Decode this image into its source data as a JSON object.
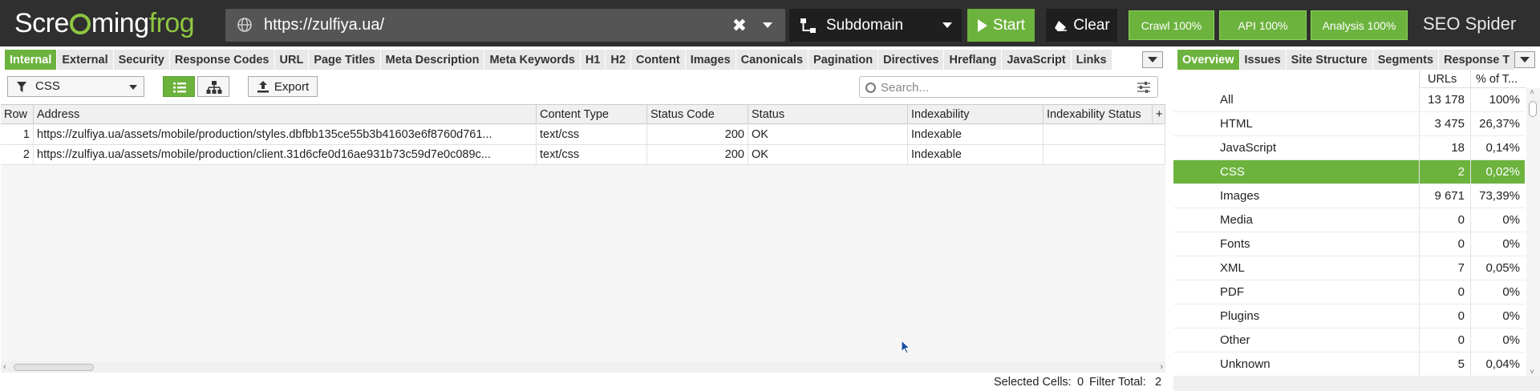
{
  "app": {
    "logo_prefix": "Scre",
    "logo_middle": "ming",
    "logo_suffix": "frog",
    "brand": "SEO Spider"
  },
  "url_bar": {
    "value": "https://zulfiya.ua/",
    "clear_glyph": "✖"
  },
  "mode": {
    "label": "Subdomain"
  },
  "buttons": {
    "start": "Start",
    "clear": "Clear",
    "export": "Export"
  },
  "progress": {
    "crawl": "Crawl 100%",
    "api": "API 100%",
    "analysis": "Analysis 100%"
  },
  "tabs_left": [
    "Internal",
    "External",
    "Security",
    "Response Codes",
    "URL",
    "Page Titles",
    "Meta Description",
    "Meta Keywords",
    "H1",
    "H2",
    "Content",
    "Images",
    "Canonicals",
    "Pagination",
    "Directives",
    "Hreflang",
    "JavaScript",
    "Links"
  ],
  "tabs_right": [
    "Overview",
    "Issues",
    "Site Structure",
    "Segments",
    "Response T"
  ],
  "filter": {
    "value": "CSS"
  },
  "search": {
    "placeholder": "Search..."
  },
  "table": {
    "columns": [
      "Row",
      "Address",
      "Content Type",
      "Status Code",
      "Status",
      "Indexability",
      "Indexability Status"
    ],
    "add_column_glyph": "+",
    "rows": [
      {
        "row": "1",
        "address": "https://zulfiya.ua/assets/mobile/production/styles.dbfbb135ce55b3b41603e6f8760d761...",
        "content_type": "text/css",
        "status_code": "200",
        "status": "OK",
        "indexability": "Indexable",
        "indexability_status": ""
      },
      {
        "row": "2",
        "address": "https://zulfiya.ua/assets/mobile/production/client.31d6cfe0d16ae931b73c59d7e0c089c...",
        "content_type": "text/css",
        "status_code": "200",
        "status": "OK",
        "indexability": "Indexable",
        "indexability_status": ""
      }
    ]
  },
  "status_bar": {
    "selected_label": "Selected Cells:",
    "selected_value": "0",
    "filter_label": "Filter Total:",
    "filter_value": "2"
  },
  "overview": {
    "headers": {
      "urls": "URLs",
      "pct": "% of T..."
    },
    "rows": [
      {
        "label": "All",
        "count": "13 178",
        "pct": "100%",
        "selected": false
      },
      {
        "label": "HTML",
        "count": "3 475",
        "pct": "26,37%",
        "selected": false
      },
      {
        "label": "JavaScript",
        "count": "18",
        "pct": "0,14%",
        "selected": false
      },
      {
        "label": "CSS",
        "count": "2",
        "pct": "0,02%",
        "selected": true
      },
      {
        "label": "Images",
        "count": "9 671",
        "pct": "73,39%",
        "selected": false
      },
      {
        "label": "Media",
        "count": "0",
        "pct": "0%",
        "selected": false
      },
      {
        "label": "Fonts",
        "count": "0",
        "pct": "0%",
        "selected": false
      },
      {
        "label": "XML",
        "count": "7",
        "pct": "0,05%",
        "selected": false
      },
      {
        "label": "PDF",
        "count": "0",
        "pct": "0%",
        "selected": false
      },
      {
        "label": "Plugins",
        "count": "0",
        "pct": "0%",
        "selected": false
      },
      {
        "label": "Other",
        "count": "0",
        "pct": "0%",
        "selected": false
      },
      {
        "label": "Unknown",
        "count": "5",
        "pct": "0,04%",
        "selected": false
      }
    ]
  },
  "colors": {
    "accent": "#6cb33e",
    "topbar": "#2f2f2f",
    "urlbar": "#555555"
  },
  "icons": [
    "globe-icon",
    "clear-icon",
    "subdomain-icon",
    "play-icon",
    "eraser-icon",
    "filter-icon",
    "list-view-icon",
    "tree-view-icon",
    "upload-icon",
    "search-icon",
    "sliders-icon",
    "mouse-cursor-icon"
  ]
}
